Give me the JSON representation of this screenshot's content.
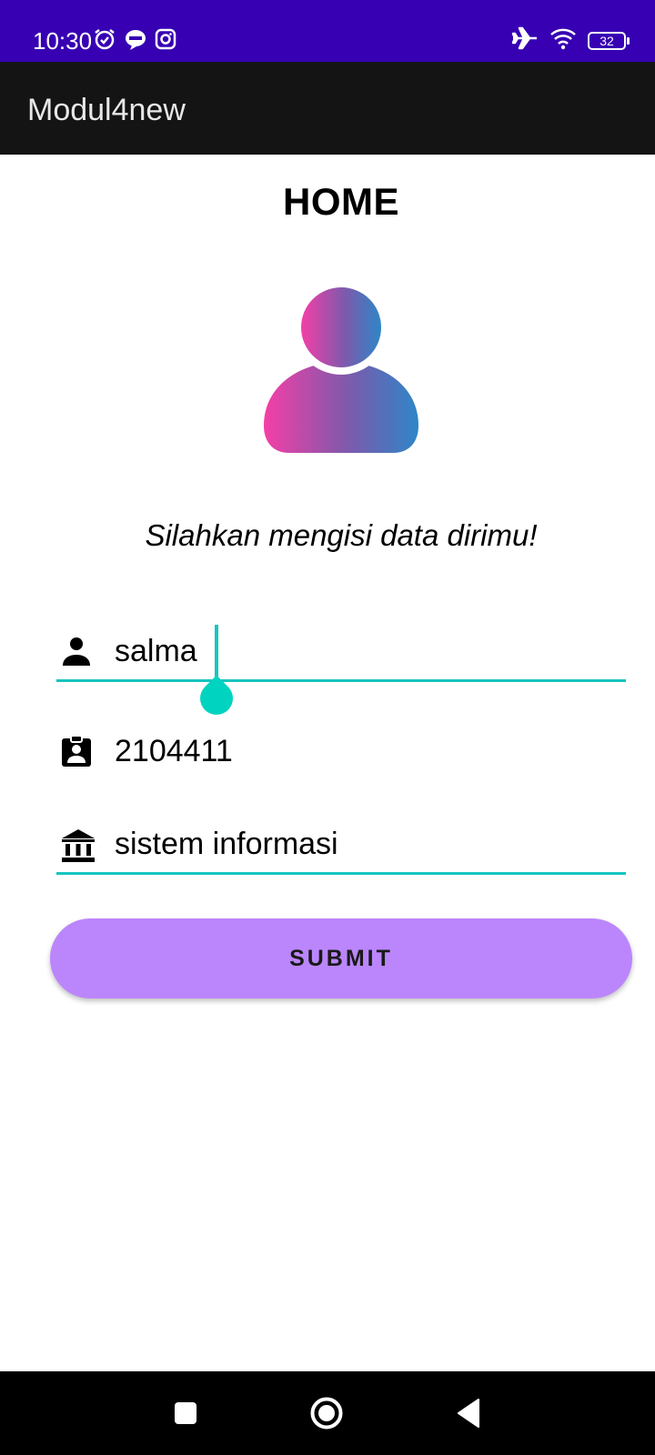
{
  "status_bar": {
    "time": "10:30",
    "left_icons": [
      "alarm-icon",
      "line-icon",
      "instagram-icon"
    ],
    "right_icons": [
      "airplane-mode-icon",
      "wifi-icon"
    ],
    "battery": "32"
  },
  "app_bar": {
    "title": "Modul4new"
  },
  "main": {
    "heading": "HOME",
    "avatar_icon": "person-avatar-icon",
    "subtitle": "Silahkan mengisi data dirimu!",
    "fields": [
      {
        "icon": "person-icon",
        "value": "salma"
      },
      {
        "icon": "badge-icon",
        "value": "2104411"
      },
      {
        "icon": "institution-icon",
        "value": "sistem informasi"
      }
    ],
    "submit_label": "SUBMIT"
  },
  "colors": {
    "status_bar": "#3700b3",
    "app_bar": "#141414",
    "accent": "#16c4c0",
    "button": "#bb86fc"
  },
  "nav_bar": {
    "buttons": [
      "recents-icon",
      "home-icon",
      "back-icon"
    ]
  }
}
